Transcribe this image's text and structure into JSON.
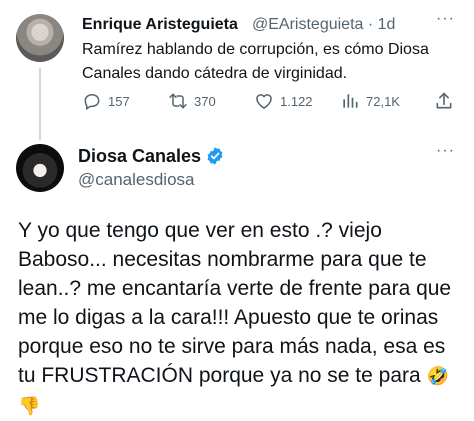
{
  "parent_tweet": {
    "name": "Enrique Aristeguieta",
    "handle": "@EAristeguieta",
    "separator": "·",
    "time": "1d",
    "more_label": "···",
    "text": "Ramírez hablando de corrupción, es cómo Diosa Canales dando cátedra de virginidad.",
    "replies": "157",
    "retweets": "370",
    "likes": "1.122",
    "views": "72,1K"
  },
  "reply_tweet": {
    "name": "Diosa Canales",
    "handle": "@canalesdiosa",
    "more_label": "···",
    "text": "Y yo que tengo que ver en esto .? viejo Baboso... necesitas nombrarme para que te lean..? me encantaría verte de frente para que me lo digas a la cara!!! Apuesto que te orinas porque eso no te sirve para más nada, esa es tu FRUSTRACIÓN porque ya no se te para",
    "emoji_1": "🤣",
    "emoji_2": "👎"
  },
  "colors": {
    "text": "#0f1419",
    "secondary": "#536471",
    "verified": "#1d9bf0",
    "thread_line": "#cfd9de"
  },
  "icons": [
    "reply-icon",
    "retweet-icon",
    "like-icon",
    "views-icon",
    "share-icon",
    "verified-badge-icon",
    "more-icon"
  ]
}
